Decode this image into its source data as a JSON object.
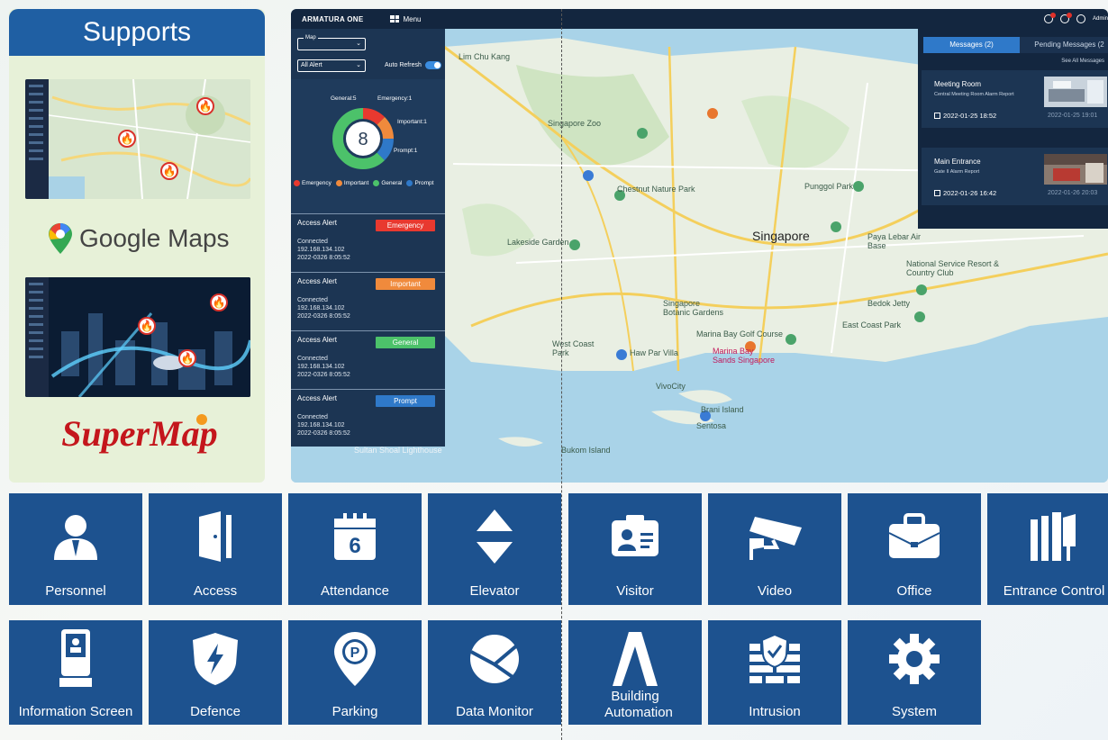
{
  "supports": {
    "title": "Supports",
    "google_maps_label": "Google Maps",
    "supermap_label": "SuperMap"
  },
  "dashboard": {
    "brand": "ARMATURA ONE",
    "menu_label": "Menu",
    "admin_label": "Admin",
    "map_select": {
      "legend": "Map",
      "value": ""
    },
    "alert_select": {
      "value": "All Alert"
    },
    "auto_refresh_label": "Auto Refresh",
    "auto_refresh_on": true,
    "donut": {
      "total": "8",
      "general": "General:5",
      "emergency": "Emergency:1",
      "important": "Important:1",
      "prompt": "Prompt:1",
      "segments": {
        "general": 5,
        "emergency": 1,
        "important": 1,
        "prompt": 1
      }
    },
    "legend": [
      {
        "label": "Emergency",
        "color": "#e8392f"
      },
      {
        "label": "Important",
        "color": "#f08a3c"
      },
      {
        "label": "General",
        "color": "#4cc26a"
      },
      {
        "label": "Prompt",
        "color": "#2f79c9"
      }
    ],
    "alerts": [
      {
        "title": "Access Alert",
        "level": "Emergency",
        "color": "#e8392f",
        "status": "Connected",
        "ip": "192.168.134.102",
        "time": "2022-0326 8:05:52"
      },
      {
        "title": "Access Alert",
        "level": "Important",
        "color": "#f08a3c",
        "status": "Connected",
        "ip": "192.168.134.102",
        "time": "2022-0326 8:05:52"
      },
      {
        "title": "Access Alert",
        "level": "General",
        "color": "#4cc26a",
        "status": "Connected",
        "ip": "192.168.134.102",
        "time": "2022-0326 8:05:52"
      },
      {
        "title": "Access Alert",
        "level": "Prompt",
        "color": "#2f79c9",
        "status": "Connected",
        "ip": "192.168.134.102",
        "time": "2022-0326 8:05:52"
      }
    ],
    "messages": {
      "tab_messages": "Messages (2)",
      "tab_pending": "Pending Messages (2",
      "see_all": "See All Messages",
      "items": [
        {
          "title": "Meeting Room",
          "subtitle": "Central Meeting Room Alarm Report",
          "date": "2022-01-25 18:52",
          "date2": "2022-01-25 19:01"
        },
        {
          "title": "Main Entrance",
          "subtitle": "Gate II Alarm Report",
          "date": "2022-01-26 16:42",
          "date2": "2022-01-26 20:03"
        }
      ]
    },
    "map_labels": {
      "singapore": "Singapore",
      "botanic": "Singapore Botanic Gardens",
      "zoo": "Singapore Zoo",
      "lakeside": "Lakeside Garden",
      "marina": "Marina Bay Golf Course",
      "sands": "Marina Bay Sands Singapore",
      "punggol": "Punggol Park",
      "hawpar": "Haw Par Villa",
      "vivocity": "VivoCity",
      "sentosa": "Sentosa",
      "brani": "Brani Island",
      "bukom": "Bukom Island",
      "chestnut": "Chestnut Nature Park",
      "paya": "Paya Lebar Air Base",
      "westcoast": "West Coast Park",
      "national": "National Service Resort & Country Club",
      "bedok": "Bedok Jetty",
      "eastcoast": "East Coast Park",
      "sultan": "Sultan Shoal Lighthouse",
      "lim": "Lim Chu Kang"
    }
  },
  "modules": [
    {
      "label": "Personnel",
      "icon": "person-icon"
    },
    {
      "label": "Access",
      "icon": "door-icon"
    },
    {
      "label": "Attendance",
      "icon": "calendar-icon",
      "day": "6"
    },
    {
      "label": "Elevator",
      "icon": "elevator-arrows-icon"
    },
    {
      "label": "Visitor",
      "icon": "visitor-badge-icon"
    },
    {
      "label": "Video",
      "icon": "cctv-camera-icon"
    },
    {
      "label": "Office",
      "icon": "briefcase-icon"
    },
    {
      "label": "Entrance Control",
      "icon": "turnstile-icon"
    },
    {
      "label": "Information Screen",
      "icon": "kiosk-icon"
    },
    {
      "label": "Defence",
      "icon": "shield-bolt-icon"
    },
    {
      "label": "Parking",
      "icon": "parking-pin-icon"
    },
    {
      "label": "Data Monitor",
      "icon": "pie-monitor-icon"
    },
    {
      "label": "Building Automation",
      "icon": "automation-a-icon"
    },
    {
      "label": "Intrusion",
      "icon": "brick-wall-shield-icon"
    },
    {
      "label": "System",
      "icon": "gear-icon"
    }
  ]
}
